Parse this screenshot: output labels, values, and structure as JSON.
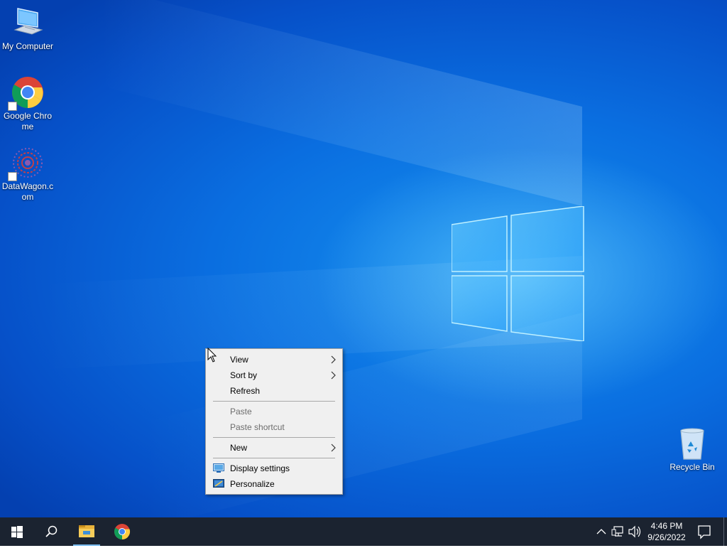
{
  "desktop": {
    "icons": [
      {
        "label": "My Computer",
        "icon": "monitor-icon"
      },
      {
        "label": "Google Chrome",
        "icon": "chrome-icon"
      },
      {
        "label": "DataWagon.com",
        "icon": "datawagon-icon"
      },
      {
        "label": "Recycle Bin",
        "icon": "recycle-bin-icon"
      }
    ]
  },
  "context_menu": {
    "items": [
      {
        "label": "View",
        "has_submenu": true,
        "enabled": true
      },
      {
        "label": "Sort by",
        "has_submenu": true,
        "enabled": true
      },
      {
        "label": "Refresh",
        "has_submenu": false,
        "enabled": true
      },
      {
        "label": "Paste",
        "has_submenu": false,
        "enabled": false
      },
      {
        "label": "Paste shortcut",
        "has_submenu": false,
        "enabled": false
      },
      {
        "label": "New",
        "has_submenu": true,
        "enabled": true
      },
      {
        "label": "Display settings",
        "icon": "display-settings-icon",
        "enabled": true
      },
      {
        "label": "Personalize",
        "icon": "personalize-icon",
        "enabled": true
      }
    ]
  },
  "taskbar": {
    "buttons": [
      "start-icon",
      "search-icon",
      "file-explorer-icon",
      "chrome-icon"
    ],
    "tray_icons": [
      "chevron-up-icon",
      "network-icon",
      "volume-icon"
    ],
    "clock": {
      "time": "4:46 PM",
      "date": "9/26/2022"
    },
    "colors": {
      "background": "#1b2330",
      "active_underline": "#76b9ed"
    }
  },
  "colors": {
    "desktop_blue": "#0a6ee0",
    "menu_background": "#f0f0f0",
    "menu_disabled_text": "#6d6d6d"
  }
}
